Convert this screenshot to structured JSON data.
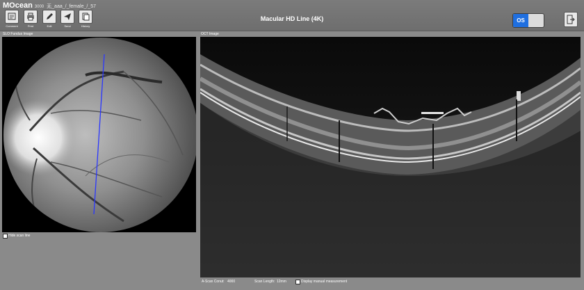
{
  "app": {
    "brand": "MOcean",
    "brand_small": "3000",
    "patient": "无_aaa_/_female_/_57"
  },
  "toolbar": [
    {
      "name": "comment",
      "label": "Comment"
    },
    {
      "name": "print",
      "label": "Print"
    },
    {
      "name": "edit",
      "label": "Edit"
    },
    {
      "name": "send",
      "label": "Send"
    },
    {
      "name": "history",
      "label": "History"
    }
  ],
  "title": "Macular HD Line (4K)",
  "eye": {
    "selected": "OS"
  },
  "fundus": {
    "label": "SLO Fundus Image",
    "hide_scan_line": "Hide scan line",
    "scan_line_color": "#2a36ff"
  },
  "oct": {
    "label": "OCT Image"
  },
  "footer": {
    "a_scan_count_label": "A-Scan Conut:",
    "a_scan_count_value": "4000",
    "scan_length_label": "Scan Length:",
    "scan_length_value": "12mm",
    "display_manual": "Display manual measurement"
  },
  "colors": {
    "accent": "#1f6fe0",
    "background": "#8a8a8a"
  }
}
